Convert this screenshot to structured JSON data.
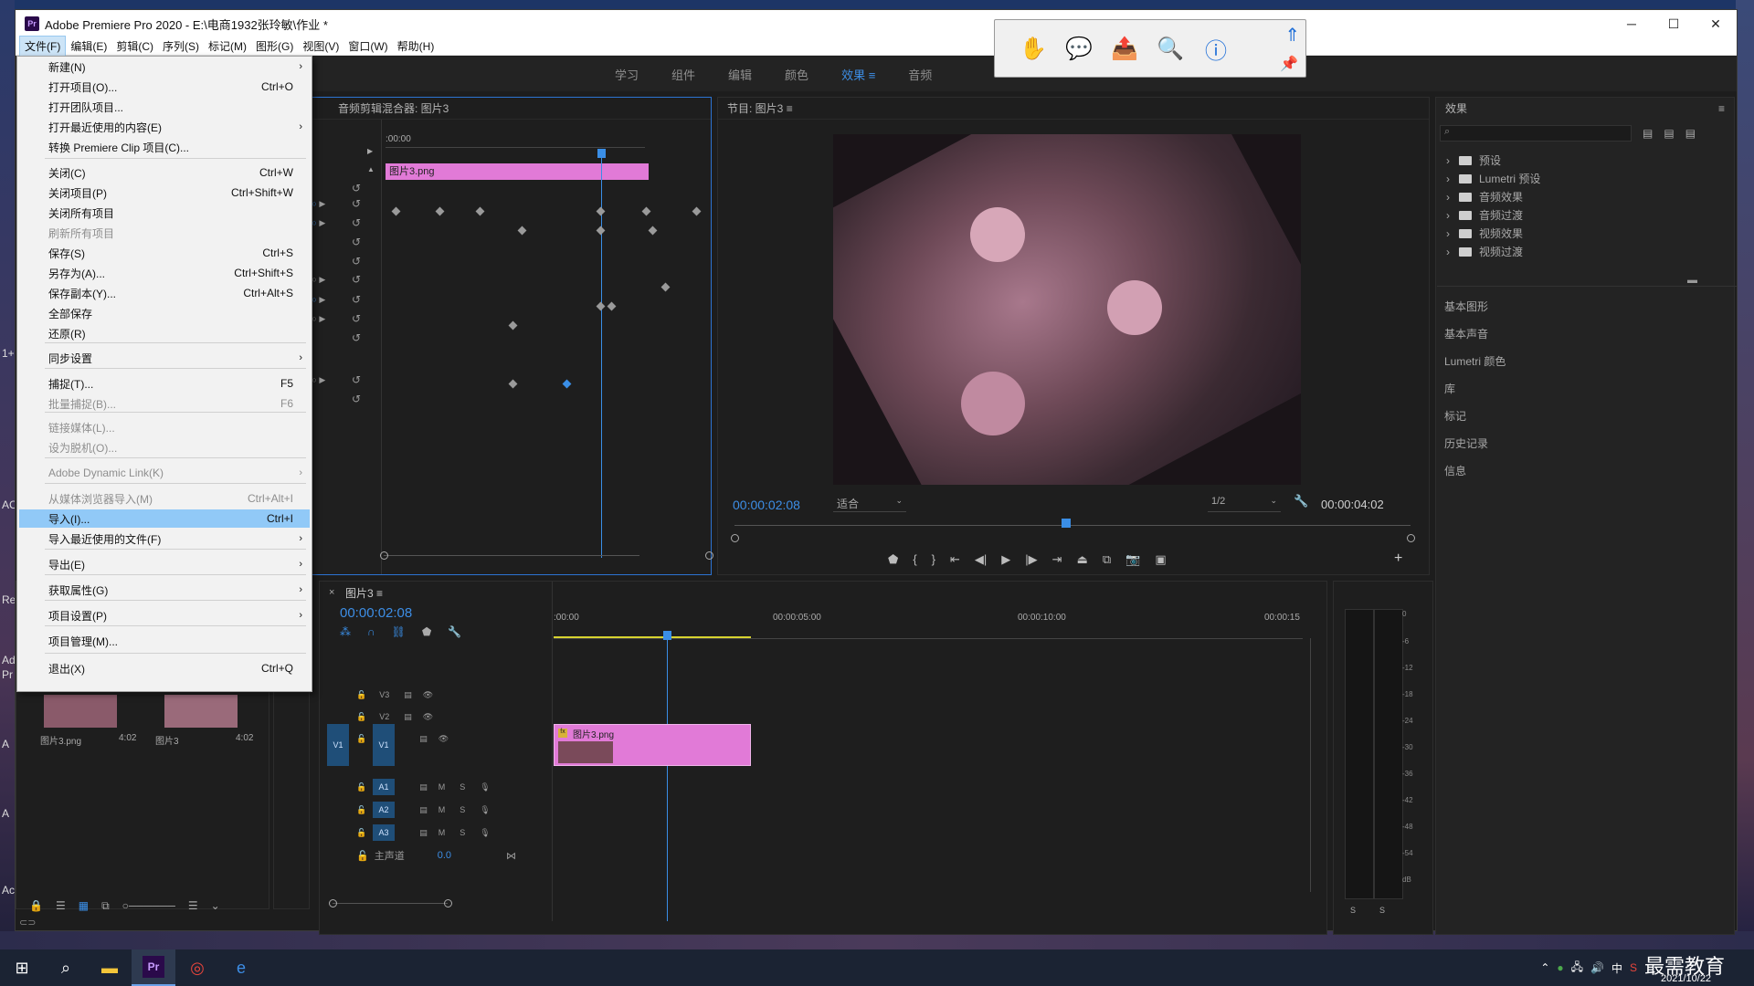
{
  "window": {
    "title": "Adobe Premiere Pro 2020 - E:\\电商1932张玲敏\\作业 *",
    "app_icon": "Pr"
  },
  "window_controls": [
    "─",
    "☐",
    "✕"
  ],
  "menubar": [
    "文件(F)",
    "编辑(E)",
    "剪辑(C)",
    "序列(S)",
    "标记(M)",
    "图形(G)",
    "视图(V)",
    "窗口(W)",
    "帮助(H)"
  ],
  "workspaces": [
    {
      "label": "学习",
      "active": false
    },
    {
      "label": "组件",
      "active": false
    },
    {
      "label": "编辑",
      "active": false
    },
    {
      "label": "颜色",
      "active": false
    },
    {
      "label": "效果",
      "active": true
    },
    {
      "label": "音频",
      "active": false
    }
  ],
  "file_menu": [
    {
      "label": "新建(N)",
      "shortcut": "",
      "submenu": true,
      "disabled": false
    },
    {
      "label": "打开项目(O)...",
      "shortcut": "Ctrl+O",
      "disabled": false
    },
    {
      "label": "打开团队项目...",
      "shortcut": "",
      "disabled": false
    },
    {
      "label": "打开最近使用的内容(E)",
      "shortcut": "",
      "submenu": true,
      "disabled": false
    },
    {
      "label": "转换 Premiere Clip 项目(C)...",
      "shortcut": "",
      "disabled": false
    },
    {
      "label": "关闭(C)",
      "shortcut": "Ctrl+W",
      "disabled": false
    },
    {
      "label": "关闭项目(P)",
      "shortcut": "Ctrl+Shift+W",
      "disabled": false
    },
    {
      "label": "关闭所有项目",
      "shortcut": "",
      "disabled": false
    },
    {
      "label": "刷新所有项目",
      "shortcut": "",
      "disabled": true
    },
    {
      "label": "保存(S)",
      "shortcut": "Ctrl+S",
      "disabled": false
    },
    {
      "label": "另存为(A)...",
      "shortcut": "Ctrl+Shift+S",
      "disabled": false
    },
    {
      "label": "保存副本(Y)...",
      "shortcut": "Ctrl+Alt+S",
      "disabled": false
    },
    {
      "label": "全部保存",
      "shortcut": "",
      "disabled": false
    },
    {
      "label": "还原(R)",
      "shortcut": "",
      "disabled": false
    },
    {
      "label": "同步设置",
      "shortcut": "",
      "submenu": true,
      "disabled": false
    },
    {
      "label": "捕捉(T)...",
      "shortcut": "F5",
      "disabled": false
    },
    {
      "label": "批量捕捉(B)...",
      "shortcut": "F6",
      "disabled": true
    },
    {
      "label": "链接媒体(L)...",
      "shortcut": "",
      "disabled": true
    },
    {
      "label": "设为脱机(O)...",
      "shortcut": "",
      "disabled": true
    },
    {
      "label": "Adobe Dynamic Link(K)",
      "shortcut": "",
      "submenu": true,
      "disabled": true
    },
    {
      "label": "从媒体浏览器导入(M)",
      "shortcut": "Ctrl+Alt+I",
      "disabled": true
    },
    {
      "label": "导入(I)...",
      "shortcut": "Ctrl+I",
      "disabled": false,
      "highlighted": true
    },
    {
      "label": "导入最近使用的文件(F)",
      "shortcut": "",
      "submenu": true,
      "disabled": false
    },
    {
      "label": "导出(E)",
      "shortcut": "",
      "submenu": true,
      "disabled": false
    },
    {
      "label": "获取属性(G)",
      "shortcut": "",
      "submenu": true,
      "disabled": false
    },
    {
      "label": "项目设置(P)",
      "shortcut": "",
      "submenu": true,
      "disabled": false
    },
    {
      "label": "项目管理(M)...",
      "shortcut": "",
      "disabled": false
    },
    {
      "label": "退出(X)",
      "shortcut": "Ctrl+Q",
      "disabled": false
    }
  ],
  "source_panel": {
    "title": "音频剪辑混合器: 图片3",
    "timecode_start": ":00:00",
    "clip_label": "图片3.png"
  },
  "program_monitor": {
    "title": "节目: 图片3",
    "timecode": "00:00:02:08",
    "fit": "适合",
    "resolution": "1/2",
    "duration": "00:00:04:02",
    "playhead_fraction": 0.49
  },
  "effects_panel": {
    "title": "效果",
    "tree": [
      "预设",
      "Lumetri 预设",
      "音频效果",
      "音频过渡",
      "视频效果",
      "视频过渡"
    ],
    "sections": [
      "基本图形",
      "基本声音",
      "Lumetri 颜色",
      "库",
      "标记",
      "历史记录",
      "信息"
    ]
  },
  "timeline": {
    "tab": "图片3",
    "timecode": "00:00:02:08",
    "ruler": [
      ":00:00",
      "00:00:05:00",
      "00:00:10:00",
      "00:00:15"
    ],
    "clip_label": "图片3.png",
    "video_tracks": [
      "V3",
      "V2",
      "V1"
    ],
    "audio_tracks": [
      "A1",
      "A2",
      "A3"
    ],
    "track_ms": [
      "M",
      "S"
    ],
    "source_patch": "V1",
    "master_label": "主声道",
    "master_value": "0.0"
  },
  "meter": {
    "labels": [
      "0",
      "-6",
      "-12",
      "-18",
      "-24",
      "-30",
      "-36",
      "-42",
      "-48",
      "-54",
      "dB"
    ],
    "solo": [
      "S",
      "S"
    ]
  },
  "project_items": [
    {
      "name": "图片3.png",
      "duration": "4:02"
    },
    {
      "name": "图片3",
      "duration": "4:02"
    }
  ],
  "desktop_labels": [
    "1+",
    "AC",
    "Re",
    "Ad",
    "Pr",
    "A",
    "A",
    "Ac"
  ],
  "taskbar": {
    "date": "2021/10/22",
    "brand": "最需教育",
    "ime": "中",
    "icons": [
      "windows-icon",
      "search-icon",
      "explorer-icon",
      "premiere-icon",
      "chrome-icon",
      "edge-icon"
    ]
  },
  "colors": {
    "accent": "#3d8ee6",
    "clip_pink": "#e17ad7",
    "highlight": "#91c9f7"
  }
}
